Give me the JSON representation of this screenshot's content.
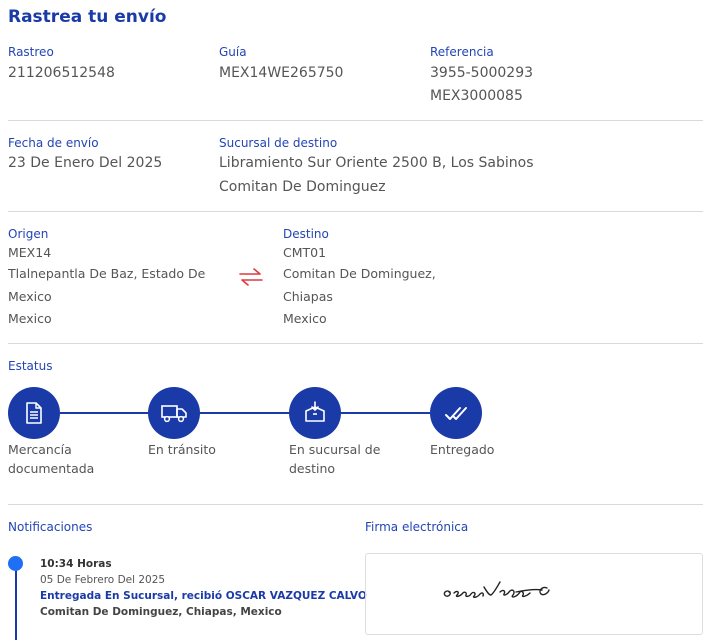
{
  "title": "Rastrea tu envío",
  "rastreo": {
    "label": "Rastreo",
    "value": "211206512548"
  },
  "guia": {
    "label": "Guía",
    "value": "MEX14WE265750"
  },
  "referencia": {
    "label": "Referencia",
    "line1": "3955-5000293",
    "line2": "MEX3000085"
  },
  "fecha_envio": {
    "label": "Fecha de envío",
    "value": "23 De Enero Del 2025"
  },
  "sucursal_destino": {
    "label": "Sucursal de destino",
    "line1": "Libramiento Sur Oriente 2500 B, Los Sabinos",
    "line2": "Comitan De Dominguez"
  },
  "origen": {
    "label": "Origen",
    "code": "MEX14",
    "line1": "Tlalnepantla De Baz, Estado De",
    "line2": "Mexico",
    "line3": "Mexico"
  },
  "destino": {
    "label": "Destino",
    "code": "CMT01",
    "line1": "Comitan De Dominguez,",
    "line2": "Chiapas",
    "line3": "Mexico"
  },
  "estatus": {
    "label": "Estatus",
    "steps": [
      {
        "icon": "document-icon",
        "line1": "Mercancía",
        "line2": "documentada"
      },
      {
        "icon": "truck-icon",
        "line1": "En tránsito",
        "line2": ""
      },
      {
        "icon": "package-icon",
        "line1": "En sucursal de",
        "line2": "destino"
      },
      {
        "icon": "double-check-icon",
        "line1": "Entregado",
        "line2": ""
      }
    ]
  },
  "notificaciones": {
    "label": "Notificaciones",
    "items": [
      {
        "time": "10:34 Horas",
        "date": "05 De Febrero Del 2025",
        "status": "Entregada En Sucursal, recibió OSCAR VAZQUEZ CALVO",
        "location": "Comitan De Dominguez, Chiapas, Mexico"
      }
    ]
  },
  "firma": {
    "label": "Firma electrónica",
    "signature_text": "oscar Vazquez C"
  },
  "colors": {
    "brand": "#1a3aa8",
    "accent_red": "#e0393e",
    "dot": "#1f6ff5"
  }
}
